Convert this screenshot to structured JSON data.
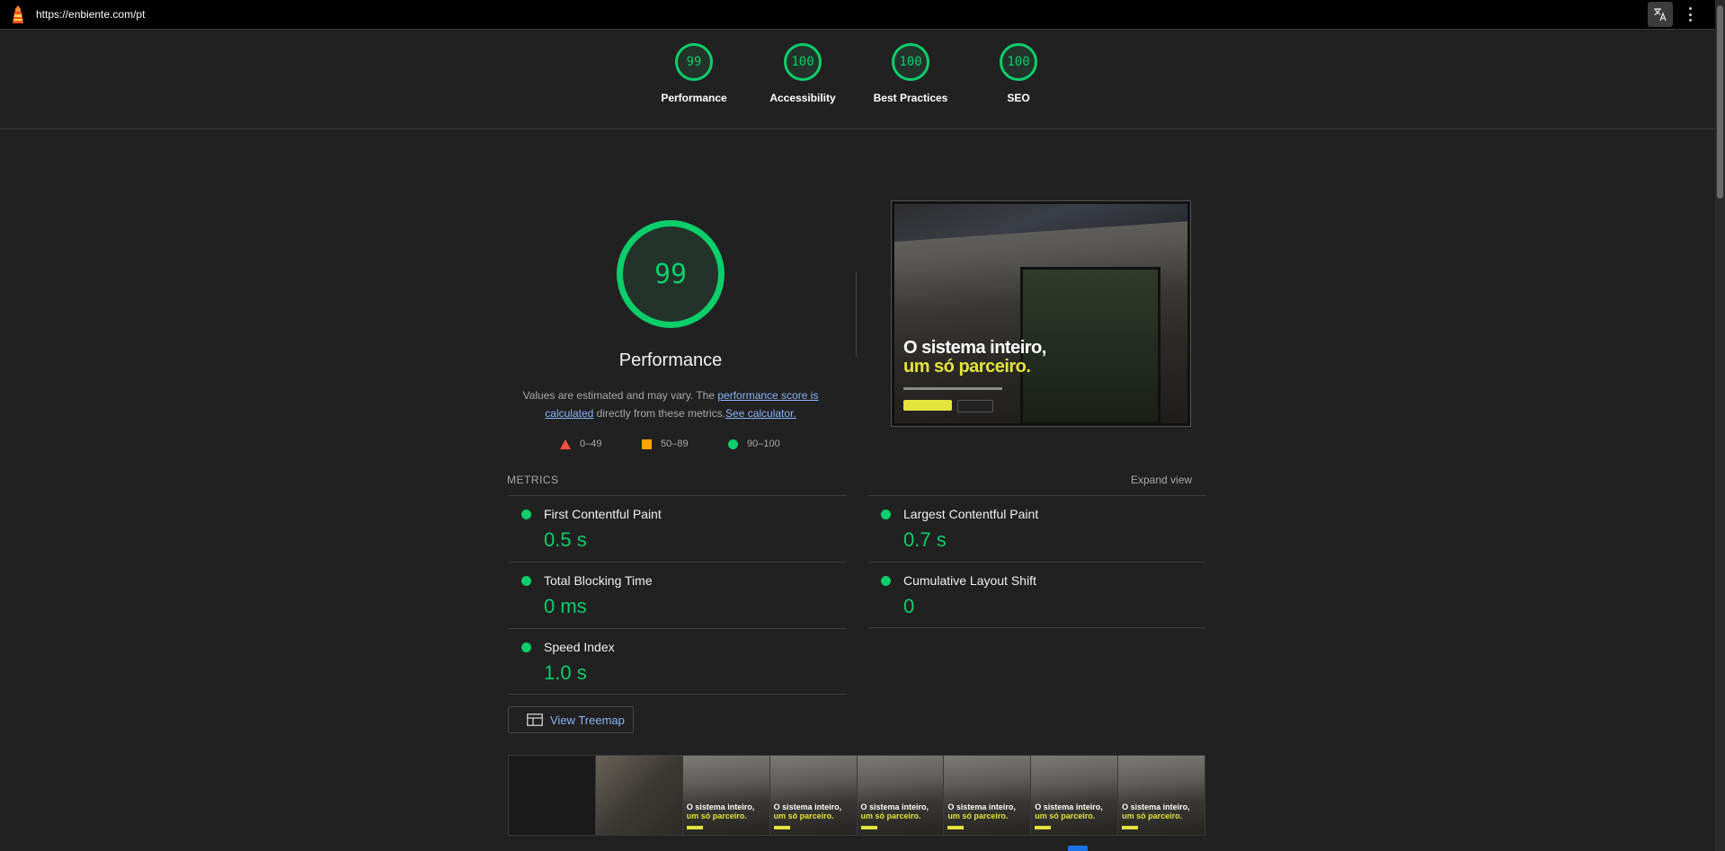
{
  "url_bar": {
    "url": "https://enbiente.com/pt"
  },
  "score_header": {
    "gauges": [
      {
        "label": "Performance",
        "score": "99"
      },
      {
        "label": "Accessibility",
        "score": "100"
      },
      {
        "label": "Best Practices",
        "score": "100"
      },
      {
        "label": "SEO",
        "score": "100"
      }
    ]
  },
  "performance": {
    "score": "99",
    "title": "Performance",
    "desc_prefix": "Values are estimated and may vary. The ",
    "desc_link1": "performance score is calculated",
    "desc_middle": " directly from these metrics.",
    "desc_link2": "See calculator.",
    "legend": [
      {
        "shape": "triangle",
        "range": "0–49",
        "color": "#ff4e42"
      },
      {
        "shape": "square",
        "range": "50–89",
        "color": "#ffa400"
      },
      {
        "shape": "circle",
        "range": "90–100",
        "color": "#0cce6b"
      }
    ]
  },
  "screenshot": {
    "headline_line1": "O sistema inteiro,",
    "headline_line2": "um só parceiro."
  },
  "metrics": {
    "label": "METRICS",
    "expand_label": "Expand view",
    "items": [
      {
        "name": "First Contentful Paint",
        "value": "0.5 s"
      },
      {
        "name": "Largest Contentful Paint",
        "value": "0.7 s"
      },
      {
        "name": "Total Blocking Time",
        "value": "0 ms"
      },
      {
        "name": "Cumulative Layout Shift",
        "value": "0"
      },
      {
        "name": "Speed Index",
        "value": "1.0 s"
      }
    ]
  },
  "treemap": {
    "label": "View Treemap"
  },
  "filmstrip": {
    "frame_text1": "O sistema inteiro,",
    "frame_text2": "um só parceiro."
  },
  "colors": {
    "pass": "#0cce6b",
    "background": "#212121",
    "link": "#8ab4f8"
  }
}
